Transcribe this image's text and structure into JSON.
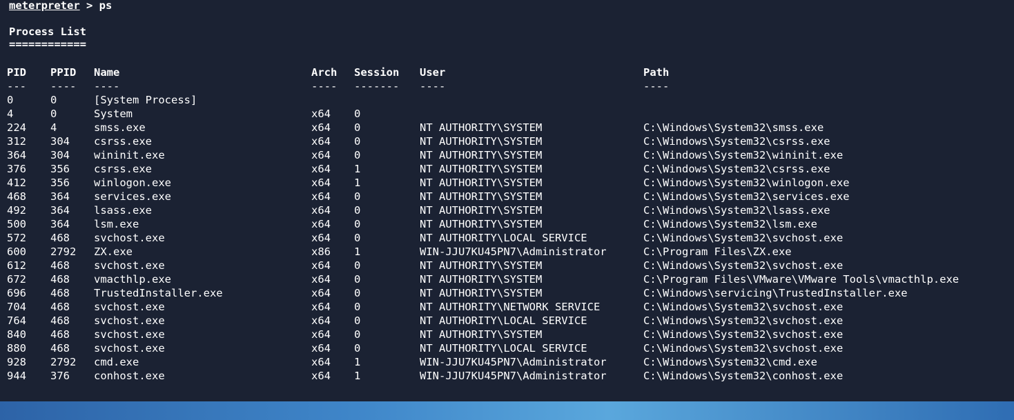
{
  "terminal": {
    "prompt_word": "meterpreter",
    "prompt_rest": " > ps",
    "title": "Process List",
    "underline": "============"
  },
  "table": {
    "headers": {
      "pid": "PID",
      "ppid": "PPID",
      "name": "Name",
      "arch": "Arch",
      "session": "Session",
      "user": "User",
      "path": "Path"
    },
    "separators": {
      "pid": "---",
      "ppid": "----",
      "name": "----",
      "arch": "----",
      "session": "-------",
      "user": "----",
      "path": "----"
    },
    "rows": [
      {
        "pid": "0",
        "ppid": "0",
        "name": "[System Process]",
        "arch": "",
        "session": "",
        "user": "",
        "path": ""
      },
      {
        "pid": "4",
        "ppid": "0",
        "name": "System",
        "arch": "x64",
        "session": "0",
        "user": "",
        "path": ""
      },
      {
        "pid": "224",
        "ppid": "4",
        "name": "smss.exe",
        "arch": "x64",
        "session": "0",
        "user": "NT AUTHORITY\\SYSTEM",
        "path": "C:\\Windows\\System32\\smss.exe"
      },
      {
        "pid": "312",
        "ppid": "304",
        "name": "csrss.exe",
        "arch": "x64",
        "session": "0",
        "user": "NT AUTHORITY\\SYSTEM",
        "path": "C:\\Windows\\System32\\csrss.exe"
      },
      {
        "pid": "364",
        "ppid": "304",
        "name": "wininit.exe",
        "arch": "x64",
        "session": "0",
        "user": "NT AUTHORITY\\SYSTEM",
        "path": "C:\\Windows\\System32\\wininit.exe"
      },
      {
        "pid": "376",
        "ppid": "356",
        "name": "csrss.exe",
        "arch": "x64",
        "session": "1",
        "user": "NT AUTHORITY\\SYSTEM",
        "path": "C:\\Windows\\System32\\csrss.exe"
      },
      {
        "pid": "412",
        "ppid": "356",
        "name": "winlogon.exe",
        "arch": "x64",
        "session": "1",
        "user": "NT AUTHORITY\\SYSTEM",
        "path": "C:\\Windows\\System32\\winlogon.exe"
      },
      {
        "pid": "468",
        "ppid": "364",
        "name": "services.exe",
        "arch": "x64",
        "session": "0",
        "user": "NT AUTHORITY\\SYSTEM",
        "path": "C:\\Windows\\System32\\services.exe"
      },
      {
        "pid": "492",
        "ppid": "364",
        "name": "lsass.exe",
        "arch": "x64",
        "session": "0",
        "user": "NT AUTHORITY\\SYSTEM",
        "path": "C:\\Windows\\System32\\lsass.exe"
      },
      {
        "pid": "500",
        "ppid": "364",
        "name": "lsm.exe",
        "arch": "x64",
        "session": "0",
        "user": "NT AUTHORITY\\SYSTEM",
        "path": "C:\\Windows\\System32\\lsm.exe"
      },
      {
        "pid": "572",
        "ppid": "468",
        "name": "svchost.exe",
        "arch": "x64",
        "session": "0",
        "user": "NT AUTHORITY\\LOCAL SERVICE",
        "path": "C:\\Windows\\System32\\svchost.exe"
      },
      {
        "pid": "600",
        "ppid": "2792",
        "name": "ZX.exe",
        "arch": "x86",
        "session": "1",
        "user": "WIN-JJU7KU45PN7\\Administrator",
        "path": "C:\\Program Files\\ZX.exe"
      },
      {
        "pid": "612",
        "ppid": "468",
        "name": "svchost.exe",
        "arch": "x64",
        "session": "0",
        "user": "NT AUTHORITY\\SYSTEM",
        "path": "C:\\Windows\\System32\\svchost.exe"
      },
      {
        "pid": "672",
        "ppid": "468",
        "name": "vmacthlp.exe",
        "arch": "x64",
        "session": "0",
        "user": "NT AUTHORITY\\SYSTEM",
        "path": "C:\\Program Files\\VMware\\VMware Tools\\vmacthlp.exe"
      },
      {
        "pid": "696",
        "ppid": "468",
        "name": "TrustedInstaller.exe",
        "arch": "x64",
        "session": "0",
        "user": "NT AUTHORITY\\SYSTEM",
        "path": "C:\\Windows\\servicing\\TrustedInstaller.exe"
      },
      {
        "pid": "704",
        "ppid": "468",
        "name": "svchost.exe",
        "arch": "x64",
        "session": "0",
        "user": "NT AUTHORITY\\NETWORK SERVICE",
        "path": "C:\\Windows\\System32\\svchost.exe"
      },
      {
        "pid": "764",
        "ppid": "468",
        "name": "svchost.exe",
        "arch": "x64",
        "session": "0",
        "user": "NT AUTHORITY\\LOCAL SERVICE",
        "path": "C:\\Windows\\System32\\svchost.exe"
      },
      {
        "pid": "840",
        "ppid": "468",
        "name": "svchost.exe",
        "arch": "x64",
        "session": "0",
        "user": "NT AUTHORITY\\SYSTEM",
        "path": "C:\\Windows\\System32\\svchost.exe"
      },
      {
        "pid": "880",
        "ppid": "468",
        "name": "svchost.exe",
        "arch": "x64",
        "session": "0",
        "user": "NT AUTHORITY\\LOCAL SERVICE",
        "path": "C:\\Windows\\System32\\svchost.exe"
      },
      {
        "pid": "928",
        "ppid": "2792",
        "name": "cmd.exe",
        "arch": "x64",
        "session": "1",
        "user": "WIN-JJU7KU45PN7\\Administrator",
        "path": "C:\\Windows\\System32\\cmd.exe"
      },
      {
        "pid": "944",
        "ppid": "376",
        "name": "conhost.exe",
        "arch": "x64",
        "session": "1",
        "user": "WIN-JJU7KU45PN7\\Administrator",
        "path": "C:\\Windows\\System32\\conhost.exe"
      }
    ]
  },
  "colors": {
    "terminal_bg": "#1b2233",
    "text": "#ffffff",
    "taskbar": "#3f86c9"
  }
}
